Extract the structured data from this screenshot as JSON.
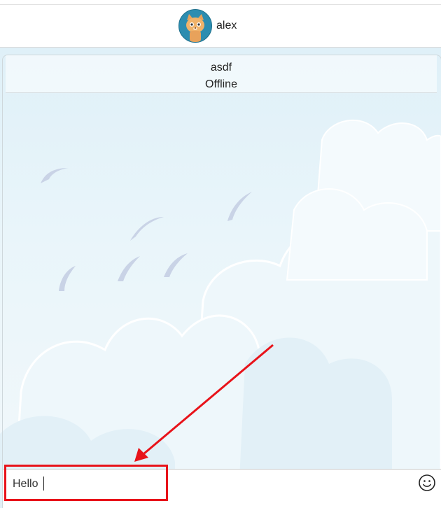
{
  "header": {
    "username": "alex",
    "avatar_icon": "cat-avatar-icon"
  },
  "chat": {
    "contact_name": "asdf",
    "contact_status": "Offline"
  },
  "composer": {
    "value": "Hello",
    "emoji_icon": "smiley-icon"
  },
  "annotation": {
    "color": "#e8131a"
  }
}
